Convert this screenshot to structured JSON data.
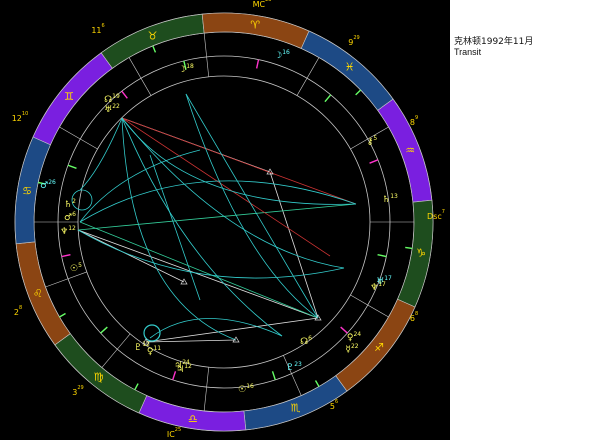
{
  "side_panel": {
    "title": "克林顿1992年11月",
    "subtitle": "Transit"
  },
  "colors": {
    "background": "#000000",
    "fire": "#8b4513",
    "earth": "#1e4d1e",
    "air": "#7a1fe0",
    "water": "#1d4a85",
    "ring_line": "#c8c8c8",
    "sign_glyph": "#ffd700",
    "planet_inner": "#ffff66",
    "planet_outer": "#66ffff",
    "aspect_green": "#33cc99",
    "aspect_cyan": "#33cccc",
    "aspect_red": "#cc3333",
    "aspect_white": "#e0e0e0",
    "cusp_tick_magenta": "#ff33cc",
    "cusp_tick_green": "#66ff66"
  },
  "angles": {
    "mc": {
      "label": "MC",
      "degree": "23"
    },
    "ic": {
      "label": "IC",
      "degree": "25"
    },
    "dsc": {
      "label": "Dsc",
      "degree": "7"
    }
  },
  "house_cusps": [
    {
      "label": "11",
      "degree": "6"
    },
    {
      "label": "9",
      "degree": "29"
    },
    {
      "label": "8",
      "degree": "9"
    },
    {
      "label": "12",
      "degree": "10"
    },
    {
      "label": "6",
      "degree": "8"
    },
    {
      "label": "5",
      "degree": "6"
    },
    {
      "label": "3",
      "degree": "29"
    },
    {
      "label": "2",
      "degree": "8"
    }
  ],
  "signs": [
    {
      "name": "taurus",
      "glyph": "♉",
      "element": "earth"
    },
    {
      "name": "aries",
      "glyph": "♈",
      "element": "fire"
    },
    {
      "name": "pisces",
      "glyph": "♓",
      "element": "water"
    },
    {
      "name": "aquarius",
      "glyph": "♒",
      "element": "air"
    },
    {
      "name": "capricorn",
      "glyph": "♑",
      "element": "earth"
    },
    {
      "name": "sagittarius",
      "glyph": "♐",
      "element": "fire"
    },
    {
      "name": "scorpio",
      "glyph": "♏",
      "element": "water"
    },
    {
      "name": "libra",
      "glyph": "♎",
      "element": "air"
    },
    {
      "name": "virgo",
      "glyph": "♍",
      "element": "earth"
    },
    {
      "name": "leo",
      "glyph": "♌",
      "element": "fire"
    },
    {
      "name": "cancer",
      "glyph": "♋",
      "element": "water"
    },
    {
      "name": "gemini",
      "glyph": "♊",
      "element": "air"
    }
  ],
  "inner_planets": [
    {
      "name": "moon",
      "glyph": "☽",
      "degree": "18"
    },
    {
      "name": "north-node",
      "glyph": "☊",
      "degree": "19"
    },
    {
      "name": "uranus",
      "glyph": "♅",
      "degree": "22"
    },
    {
      "name": "saturn",
      "glyph": "♄",
      "degree": "2"
    },
    {
      "name": "mars",
      "glyph": "♂",
      "degree": "6"
    },
    {
      "name": "neptune",
      "glyph": "♆",
      "degree": "12"
    },
    {
      "name": "sun",
      "glyph": "☉",
      "degree": "5"
    },
    {
      "name": "pluto",
      "glyph": "♇",
      "degree": "12"
    },
    {
      "name": "venus",
      "glyph": "♀",
      "degree": "11"
    },
    {
      "name": "jupiter",
      "glyph": "♃",
      "degree": "24"
    }
  ],
  "outer_planets": [
    {
      "name": "moon",
      "glyph": "☽",
      "degree": "16"
    },
    {
      "name": "chiron",
      "glyph": "⚷",
      "degree": "5"
    },
    {
      "name": "saturn",
      "glyph": "♄",
      "degree": "13"
    },
    {
      "name": "uranus",
      "glyph": "♅",
      "degree": "17"
    },
    {
      "name": "neptune",
      "glyph": "♆",
      "degree": "17"
    },
    {
      "name": "venus",
      "glyph": "♀",
      "degree": "24"
    },
    {
      "name": "mercury",
      "glyph": "☿",
      "degree": "22"
    },
    {
      "name": "pluto",
      "glyph": "♇",
      "degree": "23"
    },
    {
      "name": "north-node",
      "glyph": "☊",
      "degree": "6"
    },
    {
      "name": "sun",
      "glyph": "☉",
      "degree": "16"
    },
    {
      "name": "mars",
      "glyph": "♂",
      "degree": "26"
    },
    {
      "name": "jupiter",
      "glyph": "♃",
      "degree": "12"
    }
  ]
}
